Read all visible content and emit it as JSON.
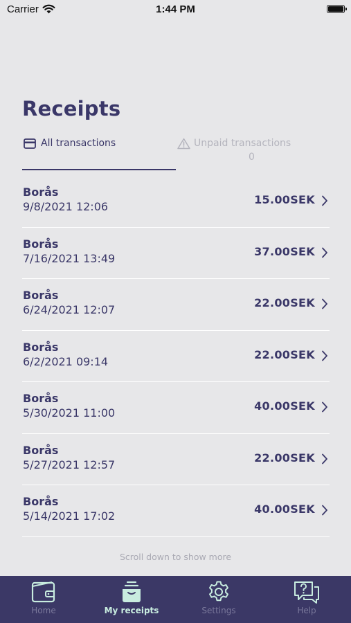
{
  "status_bar": {
    "carrier": "Carrier",
    "time": "1:44 PM"
  },
  "page": {
    "title": "Receipts"
  },
  "tabs": {
    "all": {
      "label": "All transactions",
      "icon": "credit-card-icon"
    },
    "unpaid": {
      "label": "Unpaid transactions",
      "count": "0",
      "icon": "warning-icon"
    }
  },
  "receipts": [
    {
      "city": "Borås",
      "date": "9/8/2021 12:06",
      "amount": "15.00SEK"
    },
    {
      "city": "Borås",
      "date": "7/16/2021 13:49",
      "amount": "37.00SEK"
    },
    {
      "city": "Borås",
      "date": "6/24/2021 12:07",
      "amount": "22.00SEK"
    },
    {
      "city": "Borås",
      "date": "6/2/2021 09:14",
      "amount": "22.00SEK"
    },
    {
      "city": "Borås",
      "date": "5/30/2021 11:00",
      "amount": "40.00SEK"
    },
    {
      "city": "Borås",
      "date": "5/27/2021 12:57",
      "amount": "22.00SEK"
    },
    {
      "city": "Borås",
      "date": "5/14/2021 17:02",
      "amount": "40.00SEK"
    }
  ],
  "footer": {
    "scroll_hint": "Scroll down to show more"
  },
  "tabbar": [
    {
      "label": "Home",
      "icon": "wallet-icon",
      "active": false
    },
    {
      "label": "My receipts",
      "icon": "receipts-box-icon",
      "active": true
    },
    {
      "label": "Settings",
      "icon": "gear-icon",
      "active": false
    },
    {
      "label": "Help",
      "icon": "help-chat-icon",
      "active": false
    }
  ],
  "colors": {
    "primary": "#3a3768",
    "tabbar_bg": "#3b3866",
    "active_tab": "#c8ecdf",
    "background": "#e7e7e9"
  }
}
